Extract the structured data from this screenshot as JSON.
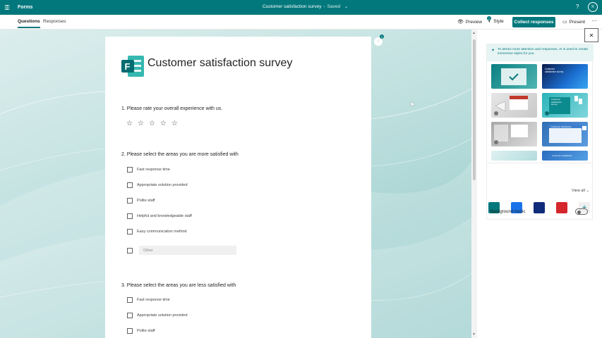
{
  "topbar": {
    "app_name": "Forms",
    "doc_title": "Customer satisfaction survey",
    "saved": "Saved",
    "help": "?",
    "avatar": "R"
  },
  "cmdbar": {
    "tabs": [
      {
        "label": "Questions"
      },
      {
        "label": "Responses"
      }
    ],
    "preview": "Preview",
    "style": "Style",
    "style_badge": "1",
    "collect": "Collect responses",
    "present": "Present",
    "more": "···"
  },
  "form": {
    "title": "Customer satisfaction survey",
    "q1": "1. Please rate your overall experience with us.",
    "q2": "2. Please select the areas you are more satisfied with",
    "q2_options": [
      "Fast response time",
      "Appropriate solution provided",
      "Polite staff",
      "Helpful and knowledgeable staff",
      "Easy communication method"
    ],
    "other": "Other",
    "q3": "3. Please select the areas you are less satisfied with",
    "q3_options": [
      "Fast response time",
      "Appropriate solution provided",
      "Polite staff"
    ],
    "rating": {
      "value": 0,
      "max": 5
    }
  },
  "float_badge": "2",
  "panel": {
    "tip": "To attract more attention and responses, AI is used to create immersive styles for you.",
    "view_all": "View all",
    "thumb_texts": {
      "t2": "Customer satisfaction survey",
      "t4": "Customer satisfaction survey",
      "t6": "Customer satisfaction",
      "t8": "Customer satisfaction"
    },
    "swatches": [
      "#03787c",
      "#1a73e8",
      "#0f2b7a",
      "#d4262b"
    ],
    "background_music": "Background music"
  },
  "colors": {
    "accent": "#03787c"
  }
}
